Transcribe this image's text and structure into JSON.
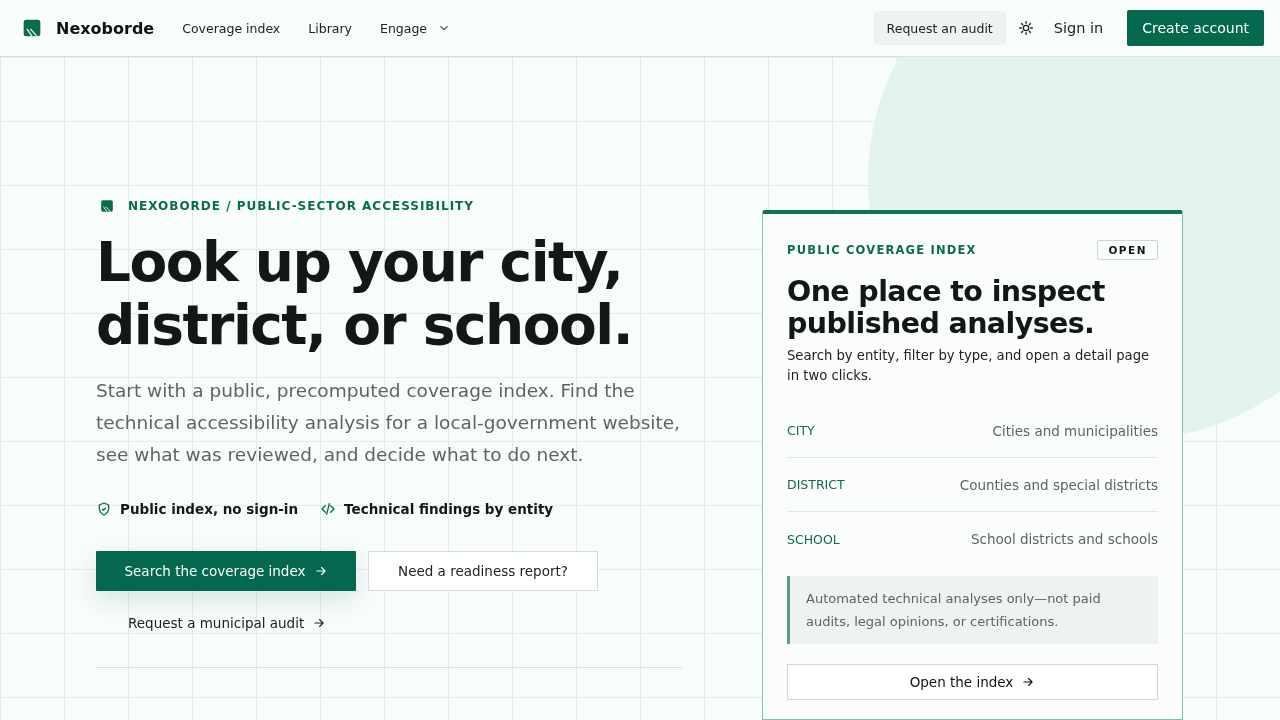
{
  "header": {
    "brand": "Nexoborde",
    "nav": [
      {
        "label": "Coverage index",
        "has_menu": false
      },
      {
        "label": "Library",
        "has_menu": false
      },
      {
        "label": "Engage",
        "has_menu": true
      }
    ],
    "audit_button": "Request an audit",
    "sign_in": "Sign in",
    "create_account": "Create account"
  },
  "hero": {
    "eyebrow": "NEXOBORDE / PUBLIC-SECTOR ACCESSIBILITY",
    "title_lines": [
      "Look up your city,",
      "district, or school."
    ],
    "lead": "Start with a public, precomputed coverage index. Find the technical accessibility analysis for a local-government website, see what was reviewed, and decide what to do next.",
    "features": [
      {
        "kind": "shield",
        "label": "Public index, no sign-in"
      },
      {
        "kind": "code",
        "label": "Technical findings by entity"
      }
    ],
    "primary_button": "Search the coverage index",
    "secondary_button": "Need a readiness report?",
    "link": "Request a municipal audit"
  },
  "card": {
    "eyebrow": "PUBLIC COVERAGE INDEX",
    "badge": "OPEN",
    "title": "One place to inspect published analyses.",
    "description": "Search by entity, filter by type, and open a detail page in two clicks.",
    "types": [
      {
        "code": "CITY",
        "label": "Cities and municipalities"
      },
      {
        "code": "DISTRICT",
        "label": "Counties and special districts"
      },
      {
        "code": "SCHOOL",
        "label": "School districts and schools"
      }
    ],
    "note": "Automated technical analyses only—not paid audits, legal opinions, or certifications.",
    "button": "Open the index"
  }
}
